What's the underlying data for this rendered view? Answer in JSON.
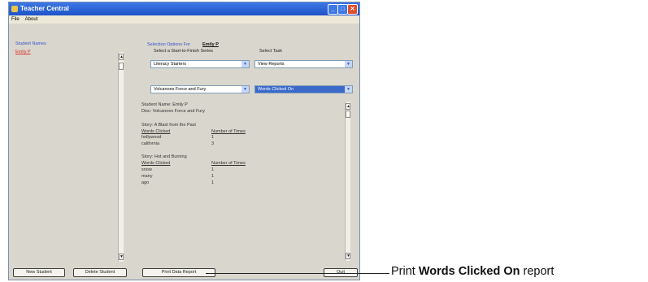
{
  "window": {
    "title": "Teacher Central"
  },
  "menu": [
    "File",
    "About"
  ],
  "students": {
    "header": "Student Names",
    "items": [
      "Emily P"
    ]
  },
  "selection": {
    "label": "Selection Options For",
    "student": "Emily P",
    "series_label": "Select a Start-to-Finish Series",
    "task_label": "Select Task",
    "series_value": "Literacy Starters",
    "task_value": "View Reports",
    "disc_value": "Volcanoes Force and Fury",
    "report_value": "Words Clicked On"
  },
  "report": {
    "student_line": "Student Name: Emily P",
    "disc_line": "Disc: Volcanoes Force and Fury",
    "col_word": "Words Clicked",
    "col_times": "Number of Times",
    "stories": [
      {
        "title": "Story: A Blast from the Past",
        "rows": [
          [
            "hollywood",
            "1"
          ],
          [
            "california",
            "3"
          ]
        ]
      },
      {
        "title": "Story: Hot and Burning",
        "rows": [
          [
            "snow",
            "1"
          ],
          [
            "many",
            "1"
          ],
          [
            "ago",
            "1"
          ]
        ]
      }
    ]
  },
  "buttons": {
    "new_student": "New Student",
    "delete_student": "Delete Student",
    "print": "Print Data Report",
    "quit": "Quit"
  },
  "annotation": {
    "prefix": "Print ",
    "bold": "Words Clicked On",
    "suffix": " report"
  }
}
